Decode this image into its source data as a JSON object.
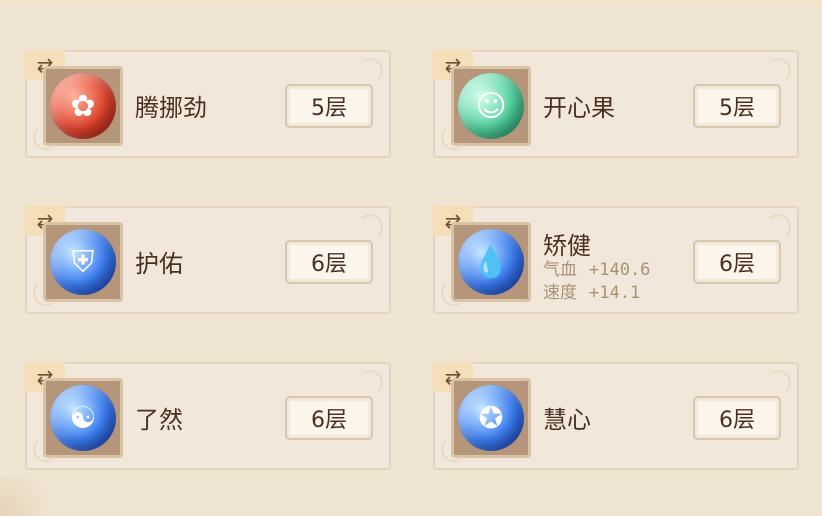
{
  "buffs": [
    {
      "name": "腾挪劲",
      "level": "5层",
      "orb_color": "red",
      "icon": "flame-spirit-icon"
    },
    {
      "name": "开心果",
      "level": "5层",
      "orb_color": "green",
      "icon": "happy-face-icon"
    },
    {
      "name": "护佑",
      "level": "6层",
      "orb_color": "blue",
      "icon": "shield-figure-icon"
    },
    {
      "name": "矫健",
      "level": "6层",
      "orb_color": "blue",
      "icon": "water-drop-icon",
      "stats": [
        {
          "label": "气血",
          "value": "+140.6"
        },
        {
          "label": "速度",
          "value": "+14.1"
        }
      ]
    },
    {
      "name": "了然",
      "level": "6层",
      "orb_color": "blue",
      "icon": "meditating-figure-icon"
    },
    {
      "name": "慧心",
      "level": "6层",
      "orb_color": "blue",
      "icon": "star-mask-icon"
    }
  ],
  "swap_glyph": "⇄",
  "orb_glyphs": [
    "✿",
    "☺",
    "⛨",
    "💧",
    "☯",
    "✪"
  ],
  "colors": {
    "background": "#efe3d1",
    "card": "#f1e7da",
    "text": "#4a3020",
    "stat_text": "#a99377"
  }
}
